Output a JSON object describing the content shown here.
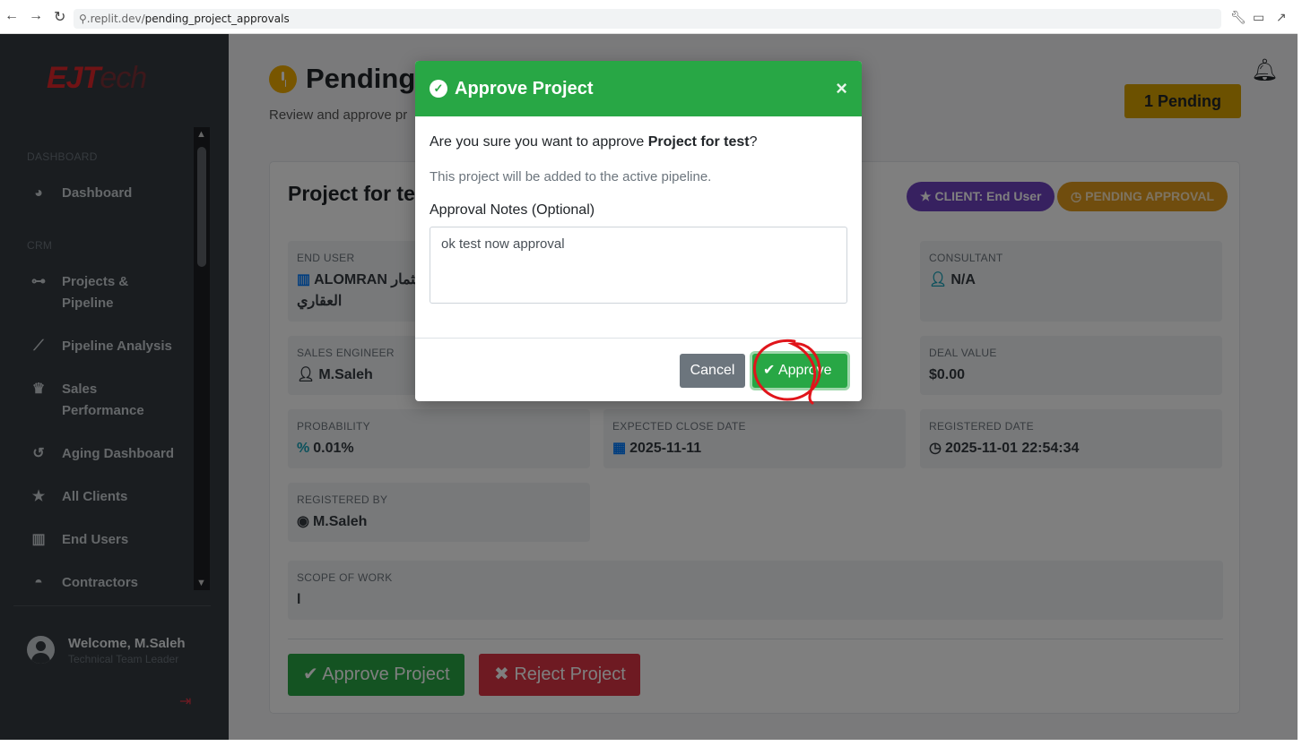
{
  "browser": {
    "url_host": ".replit.dev/",
    "url_path": "pending_project_approvals",
    "back_icon": "arrow-left-icon",
    "forward_icon": "arrow-right-icon",
    "reload_icon": "reload-icon"
  },
  "sidebar": {
    "logo_main": "EJT",
    "logo_tail": "ech",
    "sections": {
      "dashboard": "DASHBOARD",
      "crm": "CRM"
    },
    "items": [
      {
        "label": "Dashboard",
        "icon": "tachometer-icon"
      },
      {
        "label": "Projects &",
        "label2": "Pipeline",
        "icon": "sitemap-icon"
      },
      {
        "label": "Pipeline Analysis",
        "icon": "chart-line-icon"
      },
      {
        "label": "Sales",
        "label2": "Performance",
        "icon": "trophy-icon"
      },
      {
        "label": "Aging Dashboard",
        "icon": "history-icon"
      },
      {
        "label": "All Clients",
        "icon": "star-icon"
      },
      {
        "label": "End Users",
        "icon": "building-icon"
      },
      {
        "label": "Contractors",
        "icon": "hard-hat-icon"
      }
    ],
    "user": {
      "welcome": "Welcome, M.Saleh",
      "role": "Technical Team Leader"
    }
  },
  "header": {
    "title": "Pending",
    "subtitle": "Review and approve pr",
    "pending_badge": "1 Pending"
  },
  "project": {
    "title": "Project for te",
    "client_pill": "CLIENT: End User",
    "status_pill": "PENDING APPROVAL",
    "fields": {
      "end_user_label": "END USER",
      "end_user_value": "ALOMRAN استثمار",
      "end_user_value2": "العقاري",
      "consultant_label": "CONSULTANT",
      "consultant_value": "N/A",
      "sales_engineer_label": "SALES ENGINEER",
      "sales_engineer_value": "M.Saleh",
      "deal_value_label": "DEAL VALUE",
      "deal_value_value": "$0.00",
      "probability_label": "PROBABILITY",
      "probability_value": "0.01%",
      "expected_close_label": "EXPECTED CLOSE DATE",
      "expected_close_value": "2025-11-11",
      "registered_date_label": "REGISTERED DATE",
      "registered_date_value": "2025-11-01 22:54:34",
      "registered_by_label": "REGISTERED BY",
      "registered_by_value": "M.Saleh",
      "scope_label": "SCOPE OF WORK",
      "scope_value": "l"
    },
    "approve_button": "Approve Project",
    "reject_button": "Reject Project"
  },
  "modal": {
    "title": "Approve Project",
    "question_prefix": "Are you sure you want to approve ",
    "question_project": "Project for test",
    "question_suffix": "?",
    "info": "This project will be added to the active pipeline.",
    "notes_label": "Approval Notes (Optional)",
    "notes_value": "ok test now approval",
    "cancel": "Cancel",
    "approve": "Approve",
    "close_glyph": "×"
  },
  "colors": {
    "success": "#28a745",
    "danger": "#dc3545",
    "warning": "#d9a300",
    "purple": "#6f42c1",
    "sidebar": "#343a40",
    "annotation": "#e0151b"
  }
}
